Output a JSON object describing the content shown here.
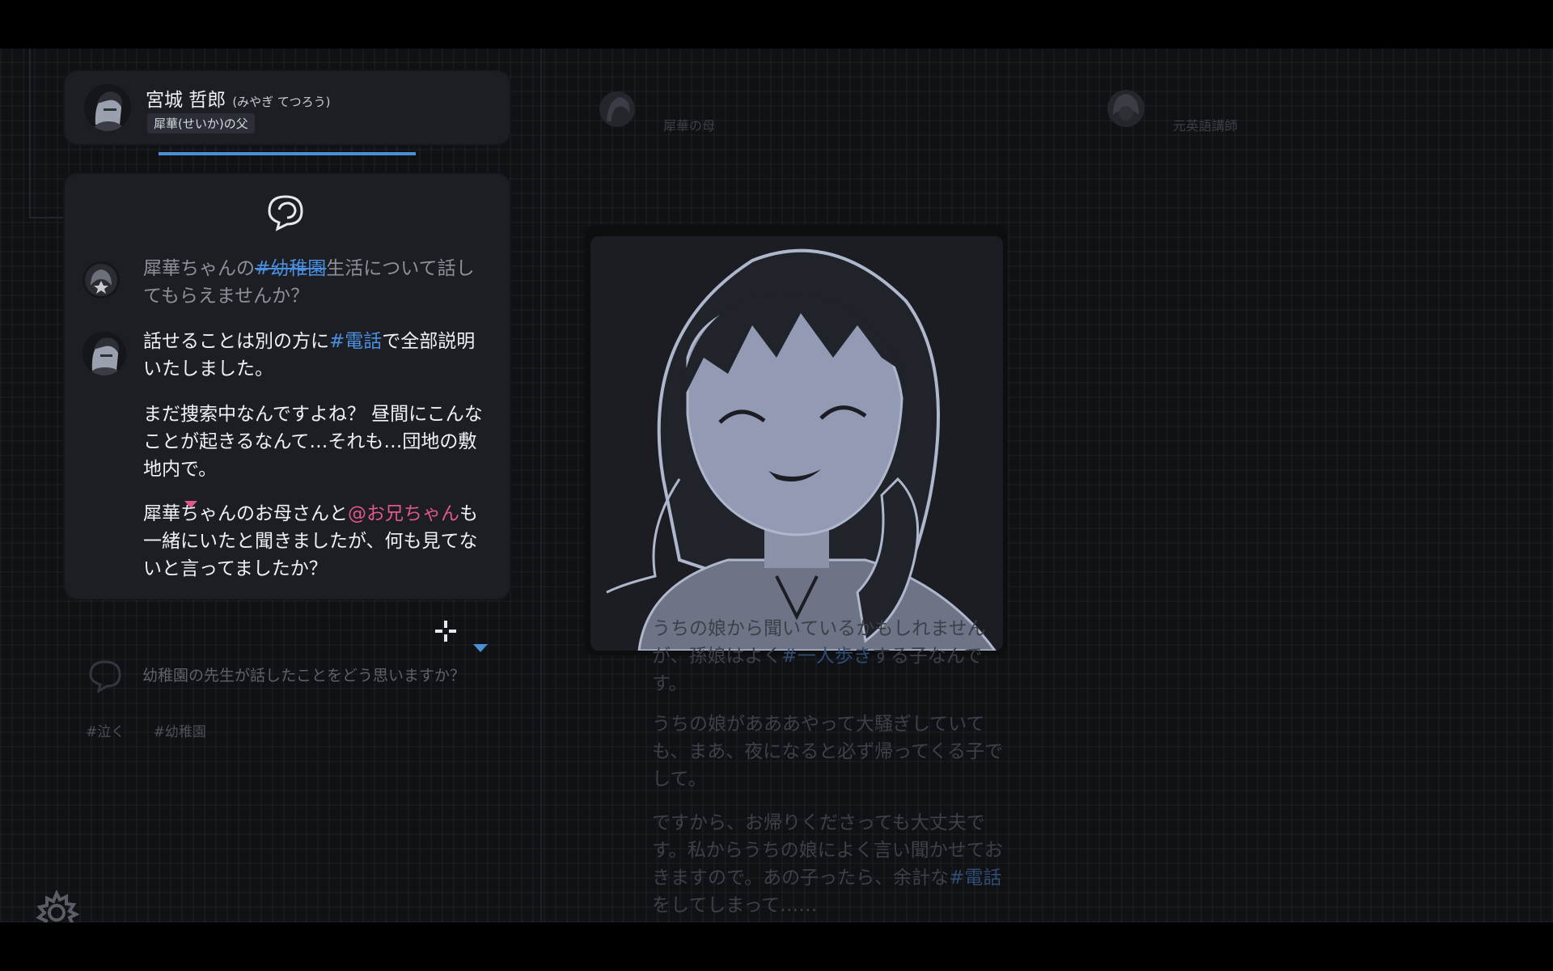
{
  "character": {
    "name": "宮城 哲郎",
    "kana": "(みやぎ てつろう)",
    "relation": "犀華(せいか)の父"
  },
  "dialogue": {
    "question_pre": "犀華ちゃんの",
    "question_tag": "#幼稚園",
    "question_post": "生活について話してもらえませんか？",
    "answer1_pre": "話せることは別の方に",
    "answer1_tag": "#電話",
    "answer1_post": "で全部説明いたしました。",
    "answer2": "まだ捜索中なんですよね？ 昼間にこんなことが起きるなんて…それも…団地の敷地内で。",
    "answer3_pre": "犀華ちゃんのお母さんと",
    "answer3_mention": "@お兄ちゃん",
    "answer3_post": "も一緒にいたと聞きましたが、何も見てないと言ってましたか？"
  },
  "next_question": "幼稚園の先生が話したことをどう思いますか？",
  "tags": [
    "#泣く",
    "#幼稚園"
  ],
  "other_characters": [
    {
      "label": "犀華の母"
    },
    {
      "label": "元英語講師"
    }
  ],
  "background_text": {
    "p1_line1": "うちの娘から聞いているかもしれません",
    "p1_pre": "が、孫娘はよく",
    "p1_tag": "#一人歩き",
    "p1_post": "する子なんです。",
    "p2": "うちの娘があああやって大騒ぎしていても、まあ、夜になると必ず帰ってくる子でして。",
    "p3_pre": "ですから、お帰りくださっても大丈夫です。私からうちの娘によく言い聞かせておきますので。あの子ったら、余計な",
    "p3_tag": "#電話",
    "p3_post": "をしてしまって……"
  },
  "colors": {
    "hashtag": "#4a90e2",
    "mention": "#e0578a",
    "progress": "#4a90d9"
  }
}
